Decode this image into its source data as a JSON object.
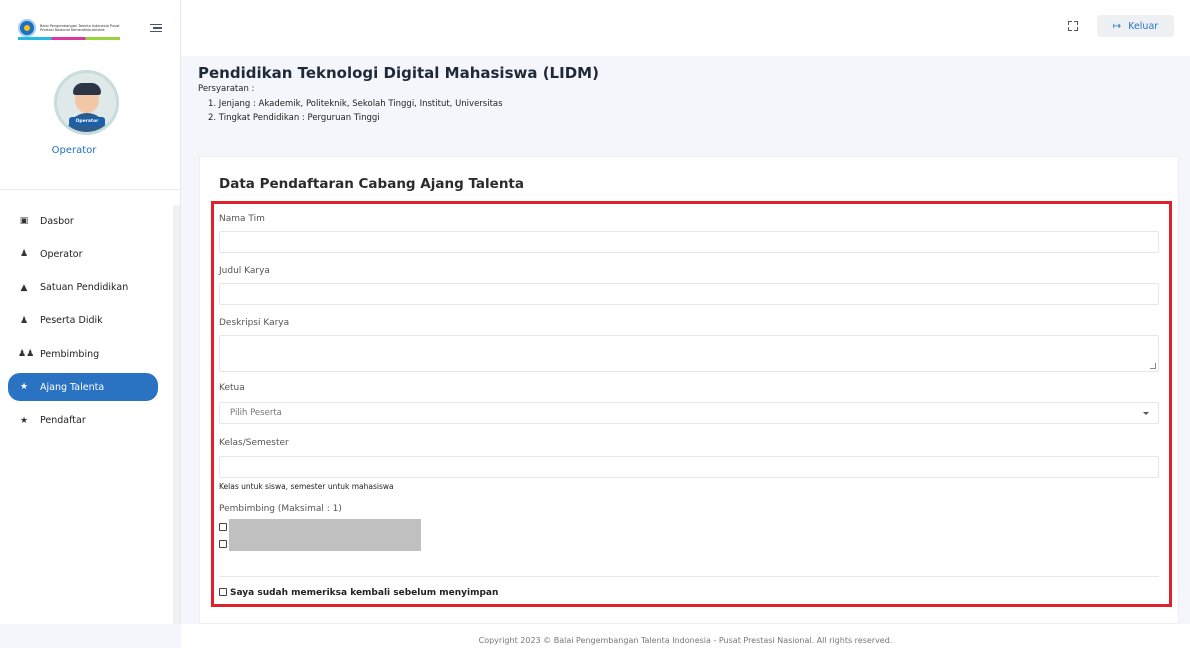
{
  "brand": {
    "logo_text": "Balai Pengembangan Talenta Indonesia Pusat Prestasi Nasional Kemendikbudristek"
  },
  "user": {
    "role": "Operator",
    "badge": "Operator"
  },
  "sidebar": {
    "items": [
      {
        "label": "Dasbor",
        "icon": "dashboard-icon"
      },
      {
        "label": "Operator",
        "icon": "user-icon"
      },
      {
        "label": "Satuan Pendidikan",
        "icon": "graduation-cap-icon"
      },
      {
        "label": "Peserta Didik",
        "icon": "user-icon"
      },
      {
        "label": "Pembimbing",
        "icon": "users-icon"
      },
      {
        "label": "Ajang Talenta",
        "icon": "trophy-icon",
        "active": true
      },
      {
        "label": "Pendaftar",
        "icon": "trophy-icon"
      }
    ]
  },
  "header": {
    "logout_label": "Keluar"
  },
  "page": {
    "title": "Pendidikan Teknologi Digital Mahasiswa (LIDM)",
    "requirements_label": "Persyaratan :",
    "requirements": [
      "1. Jenjang : Akademik, Politeknik, Sekolah Tinggi, Institut, Universitas",
      "2. Tingkat Pendidikan : Perguruan Tinggi"
    ]
  },
  "form": {
    "title": "Data Pendaftaran Cabang Ajang Talenta",
    "team_name_label": "Nama Tim",
    "team_name_value": "",
    "work_title_label": "Judul Karya",
    "work_title_value": "",
    "work_desc_label": "Deskripsi Karya",
    "work_desc_value": "",
    "leader_label": "Ketua",
    "leader_placeholder": "Pilih Peserta",
    "class_label": "Kelas/Semester",
    "class_value": "",
    "class_help": "Kelas untuk siswa, semester untuk mahasiswa",
    "mentor_label": "Pembimbing (Maksimal : 1)",
    "confirm_label": "Saya sudah memeriksa kembali sebelum menyimpan"
  },
  "footer": {
    "copyright": "Copyright 2023 © Balai Pengembangan Talenta Indonesia - Pusat Prestasi Nasional. All rights reserved."
  },
  "colors": {
    "accent": "#2a73c2",
    "highlight": "#e0202a"
  }
}
